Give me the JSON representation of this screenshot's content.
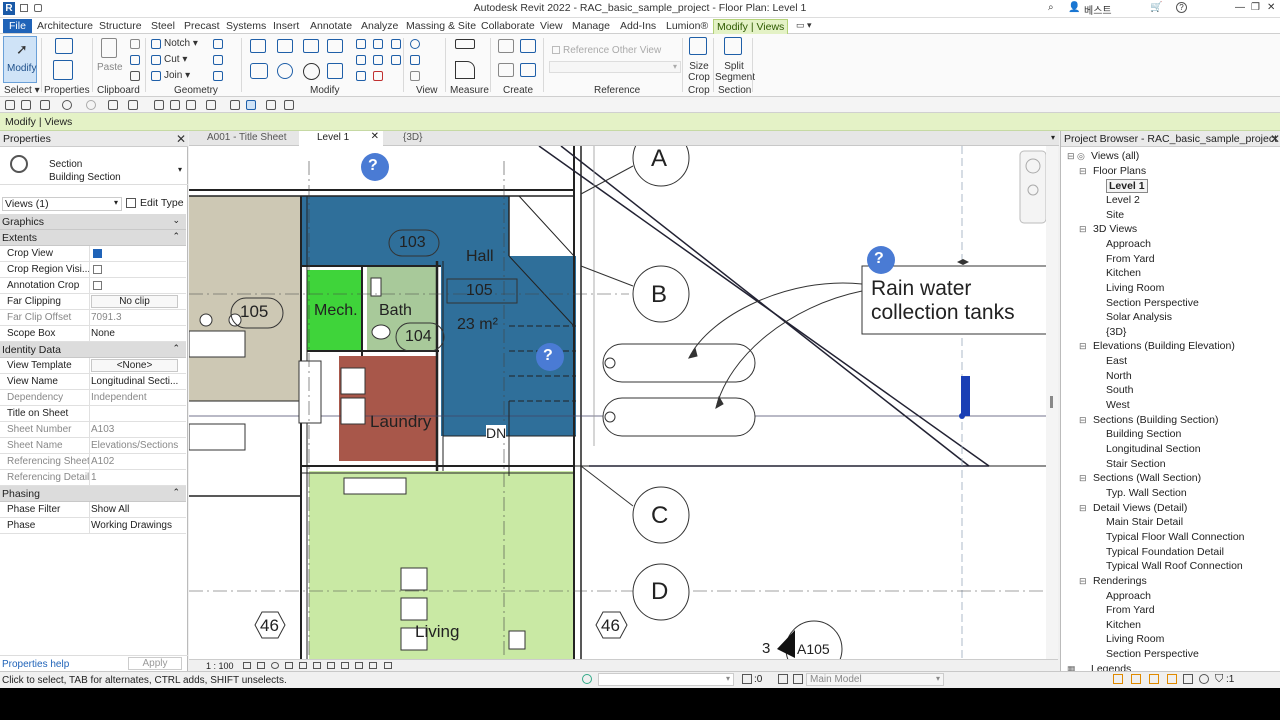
{
  "app": {
    "title": "Autodesk Revit 2022 - RAC_basic_sample_project - Floor Plan: Level 1",
    "logo": "R",
    "user": "베스트",
    "help": "?"
  },
  "menu": {
    "file": "File",
    "tabs": [
      "Architecture",
      "Structure",
      "Steel",
      "Precast",
      "Systems",
      "Insert",
      "Annotate",
      "Analyze",
      "Massing & Site",
      "Collaborate",
      "View",
      "Manage",
      "Add-Ins",
      "Lumion®"
    ],
    "active": "Modify | Views"
  },
  "ribbon": {
    "modify": "Modify",
    "paste": "Paste",
    "notch": "Notch",
    "cut": "Cut",
    "join": "Join",
    "ref_other_view": "Reference Other View",
    "size_crop": "Size Crop",
    "split_segment": "Split Segment",
    "groups": {
      "select": "Select",
      "properties": "Properties",
      "clipboard": "Clipboard",
      "geometry": "Geometry",
      "modify": "Modify",
      "view": "View",
      "measure": "Measure",
      "create": "Create",
      "reference": "Reference",
      "crop": "Crop",
      "section": "Section"
    }
  },
  "context_bar": "Modify | Views",
  "properties": {
    "title": "Properties",
    "type_name": "Section",
    "type_sub": "Building Section",
    "selector": "Views (1)",
    "edit_type": "Edit Type",
    "sections": {
      "graphics": "Graphics",
      "extents": "Extents",
      "identity": "Identity Data",
      "phasing": "Phasing"
    },
    "rows": {
      "crop_view": "Crop View",
      "crop_region_visible": "Crop Region Visi...",
      "annotation_crop": "Annotation Crop",
      "far_clipping": "Far Clipping",
      "far_clipping_val": "No clip",
      "far_clip_offset": "Far Clip Offset",
      "far_clip_offset_val": "7091.3",
      "scope_box": "Scope Box",
      "scope_box_val": "None",
      "view_template": "View Template",
      "view_template_val": "<None>",
      "view_name": "View Name",
      "view_name_val": "Longitudinal Secti...",
      "dependency": "Dependency",
      "dependency_val": "Independent",
      "title_on_sheet": "Title on Sheet",
      "sheet_number": "Sheet Number",
      "sheet_number_val": "A103",
      "sheet_name": "Sheet Name",
      "sheet_name_val": "Elevations/Sections",
      "referencing_sheet": "Referencing Sheet",
      "referencing_sheet_val": "A102",
      "referencing_detail": "Referencing Detail",
      "referencing_detail_val": "1",
      "phase_filter": "Phase Filter",
      "phase_filter_val": "Show All",
      "phase": "Phase",
      "phase_val": "Working Drawings"
    },
    "help": "Properties help",
    "apply": "Apply"
  },
  "view_tabs": [
    "A001 - Title Sheet",
    "Level 1",
    "{3D}"
  ],
  "canvas": {
    "rooms": {
      "mech": "Mech.",
      "bath": "Bath",
      "hall": "Hall",
      "laundry": "Laundry",
      "living": "Living",
      "area": "23 m²",
      "tag103": "103",
      "tag104": "104",
      "tag105a": "105",
      "tag105b": "105",
      "dn": "DN"
    },
    "grids": [
      "A",
      "B",
      "C",
      "D"
    ],
    "levels": [
      "46",
      "46"
    ],
    "annotation": [
      "Rain water",
      "collection tanks"
    ],
    "section_mark": {
      "num": "3",
      "sheet": "A105"
    },
    "scale": "1 : 100"
  },
  "browser": {
    "title": "Project Browser - RAC_basic_sample_project",
    "items": [
      {
        "t": "Views (all)",
        "lvl": 0
      },
      {
        "t": "Floor Plans",
        "lvl": 1
      },
      {
        "t": "Level 1",
        "lvl": 2,
        "bold": true
      },
      {
        "t": "Level 2",
        "lvl": 2
      },
      {
        "t": "Site",
        "lvl": 2
      },
      {
        "t": "3D Views",
        "lvl": 1
      },
      {
        "t": "Approach",
        "lvl": 2
      },
      {
        "t": "From Yard",
        "lvl": 2
      },
      {
        "t": "Kitchen",
        "lvl": 2
      },
      {
        "t": "Living Room",
        "lvl": 2
      },
      {
        "t": "Section Perspective",
        "lvl": 2
      },
      {
        "t": "Solar Analysis",
        "lvl": 2
      },
      {
        "t": "{3D}",
        "lvl": 2
      },
      {
        "t": "Elevations (Building Elevation)",
        "lvl": 1
      },
      {
        "t": "East",
        "lvl": 2
      },
      {
        "t": "North",
        "lvl": 2
      },
      {
        "t": "South",
        "lvl": 2
      },
      {
        "t": "West",
        "lvl": 2
      },
      {
        "t": "Sections (Building Section)",
        "lvl": 1
      },
      {
        "t": "Building Section",
        "lvl": 2
      },
      {
        "t": "Longitudinal Section",
        "lvl": 2
      },
      {
        "t": "Stair Section",
        "lvl": 2
      },
      {
        "t": "Sections (Wall Section)",
        "lvl": 1
      },
      {
        "t": "Typ. Wall Section",
        "lvl": 2
      },
      {
        "t": "Detail Views (Detail)",
        "lvl": 1
      },
      {
        "t": "Main Stair Detail",
        "lvl": 2
      },
      {
        "t": "Typical Floor Wall Connection",
        "lvl": 2
      },
      {
        "t": "Typical Foundation Detail",
        "lvl": 2
      },
      {
        "t": "Typical Wall Roof Connection",
        "lvl": 2
      },
      {
        "t": "Renderings",
        "lvl": 1
      },
      {
        "t": "Approach",
        "lvl": 2
      },
      {
        "t": "From Yard",
        "lvl": 2
      },
      {
        "t": "Kitchen",
        "lvl": 2
      },
      {
        "t": "Living Room",
        "lvl": 2
      },
      {
        "t": "Section Perspective",
        "lvl": 2
      },
      {
        "t": "Legends",
        "lvl": 0
      }
    ]
  },
  "status": {
    "message": "Click to select, TAB for alternates, CTRL adds, SHIFT unselects.",
    "zero": ":0",
    "model": "Main Model",
    "filter": ":1"
  },
  "colors": {
    "blue_room": "#2f6f9a",
    "green_room": "#3fd43a",
    "light_green": "#c9e9a4",
    "brown_room": "#a8574a",
    "tan_room": "#cdc8b4",
    "context": "#e4f2c6"
  }
}
